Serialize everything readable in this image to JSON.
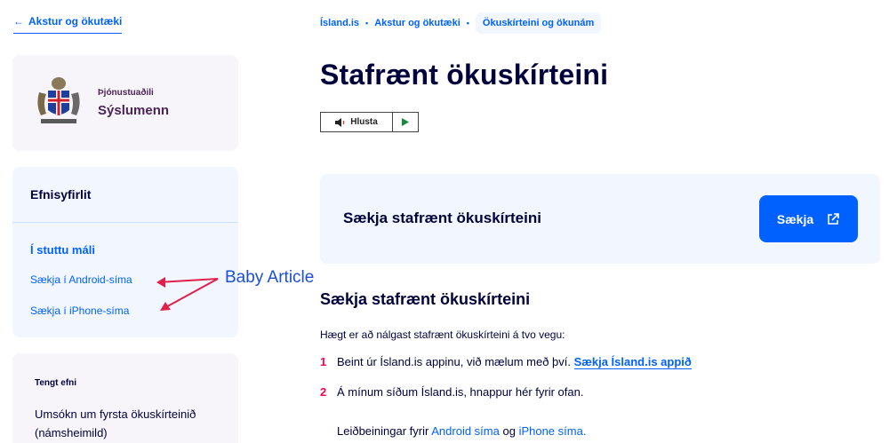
{
  "back_link": {
    "label": "Akstur og ökutæki"
  },
  "org_card": {
    "label": "Þjónustuaðili",
    "name": "Sýslumenn"
  },
  "toc": {
    "title": "Efnisyfirlit",
    "subtitle": "Í stuttu máli",
    "links": [
      "Sækja í Android-síma",
      "Sækja í iPhone-síma"
    ]
  },
  "related": {
    "title": "Tengt efni",
    "link": "Umsókn um fyrsta ökuskírteinið (námsheimild)"
  },
  "annotation": {
    "text": "Baby Article",
    "color": "#1a4fd6",
    "arrow_color": "#e0204a"
  },
  "breadcrumb": {
    "items": [
      "Ísland.is",
      "Akstur og ökutæki",
      "Ökuskírteini og ökunám"
    ],
    "separator": "•"
  },
  "page_title": "Stafrænt ökuskírteini",
  "listen": {
    "label": "Hlusta",
    "speaker_icon": "speaker-icon",
    "play_icon": "play-icon"
  },
  "download_box": {
    "title": "Sækja stafrænt ökuskírteini",
    "button_label": "Sækja",
    "button_icon": "external-link-icon"
  },
  "content": {
    "section_title": "Sækja stafrænt ökuskírteini",
    "intro": "Hægt er að nálgast stafrænt ökuskírteini á tvo vegu:",
    "steps": [
      {
        "num": "1",
        "text": "Beint úr Ísland.is appinu, við mælum með því.",
        "link": "Sækja Ísland.is appið"
      },
      {
        "num": "2",
        "text": "Á mínum síðum Ísland.is, hnappur hér fyrir ofan."
      }
    ],
    "guide": {
      "prefix": "Leiðbeiningar fyrir",
      "android": "Android síma",
      "joiner": "og",
      "iphone": "iPhone síma."
    }
  },
  "colors": {
    "accent": "#0061ff",
    "heading": "#00003c",
    "purple": "#4a2456",
    "step_number": "#ff0050"
  }
}
